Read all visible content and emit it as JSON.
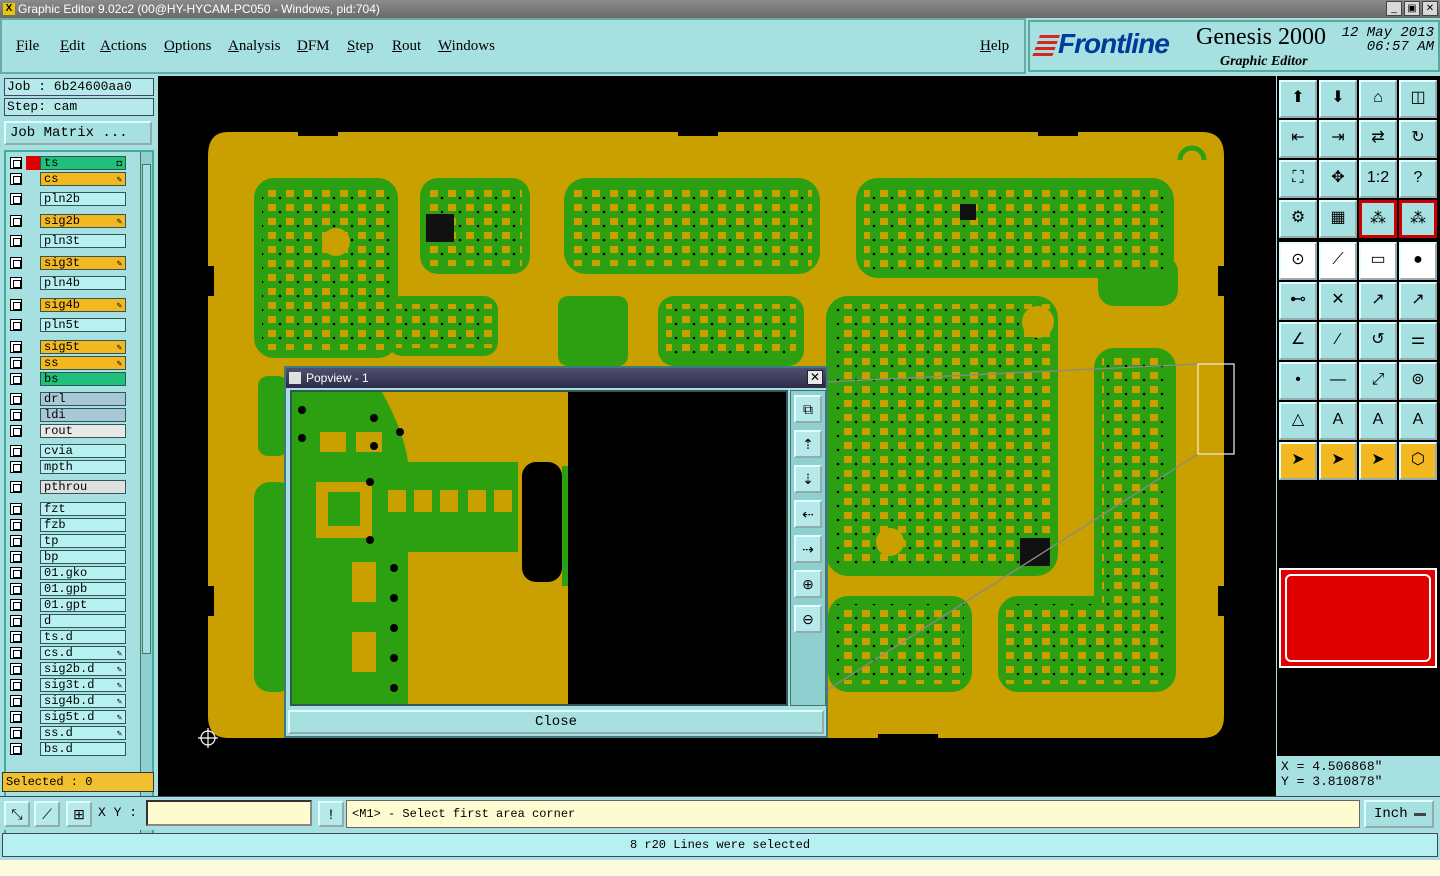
{
  "window": {
    "title": "Graphic Editor 9.02c2 (00@HY-HYCAM-PC050 - Windows, pid:704)"
  },
  "menu": {
    "items": [
      "File",
      "Edit",
      "Actions",
      "Options",
      "Analysis",
      "DFM",
      "Step",
      "Rout",
      "Windows"
    ],
    "help": "Help"
  },
  "brand": {
    "logo": "Frontline",
    "product": "Genesis 2000",
    "subtitle": "Graphic Editor",
    "date": "12 May 2013",
    "time": "06:57 AM"
  },
  "job": {
    "job_line": "Job : 6b24600aa0",
    "step_line": "Step: cam",
    "matrix_button": "Job Matrix ..."
  },
  "layers": [
    {
      "name": "ts",
      "color": "#1ec07a",
      "swatch": "#e00000",
      "pen": "◘"
    },
    {
      "name": "cs",
      "color": "#f3b820",
      "swatch": "",
      "pen": "✎"
    },
    {
      "name": "pln2b",
      "color": "#b6f0f0",
      "swatch": "",
      "pen": ""
    },
    {
      "name": "sig2b",
      "color": "#f3b820",
      "swatch": "",
      "pen": "✎"
    },
    {
      "name": "pln3t",
      "color": "#b6f0f0",
      "swatch": "",
      "pen": ""
    },
    {
      "name": "sig3t",
      "color": "#f3b820",
      "swatch": "",
      "pen": "✎"
    },
    {
      "name": "pln4b",
      "color": "#b6f0f0",
      "swatch": "",
      "pen": ""
    },
    {
      "name": "sig4b",
      "color": "#f3b820",
      "swatch": "",
      "pen": "✎"
    },
    {
      "name": "pln5t",
      "color": "#b6f0f0",
      "swatch": "",
      "pen": ""
    },
    {
      "name": "sig5t",
      "color": "#f3b820",
      "swatch": "",
      "pen": "✎"
    },
    {
      "name": "ss",
      "color": "#f3b820",
      "swatch": "",
      "pen": "✎"
    },
    {
      "name": "bs",
      "color": "#1ec07a",
      "swatch": "",
      "pen": ""
    },
    {
      "name": "drl",
      "color": "#a8c8d8",
      "swatch": "",
      "pen": ""
    },
    {
      "name": "ldi",
      "color": "#a8c8d8",
      "swatch": "",
      "pen": ""
    },
    {
      "name": "rout",
      "color": "#e8e8e8",
      "swatch": "",
      "pen": ""
    },
    {
      "name": "cvia",
      "color": "#b6f0f0",
      "swatch": "",
      "pen": ""
    },
    {
      "name": "mpth",
      "color": "#b6f0f0",
      "swatch": "",
      "pen": ""
    },
    {
      "name": "pthrou",
      "color": "#e0e0e0",
      "swatch": "",
      "pen": ""
    },
    {
      "name": "fzt",
      "color": "#b6f0f0",
      "swatch": "",
      "pen": ""
    },
    {
      "name": "fzb",
      "color": "#b6f0f0",
      "swatch": "",
      "pen": ""
    },
    {
      "name": "tp",
      "color": "#b6f0f0",
      "swatch": "",
      "pen": ""
    },
    {
      "name": "bp",
      "color": "#b6f0f0",
      "swatch": "",
      "pen": ""
    },
    {
      "name": "01.gko",
      "color": "#b6f0f0",
      "swatch": "",
      "pen": ""
    },
    {
      "name": "01.gpb",
      "color": "#b6f0f0",
      "swatch": "",
      "pen": ""
    },
    {
      "name": "01.gpt",
      "color": "#b6f0f0",
      "swatch": "",
      "pen": ""
    },
    {
      "name": "d",
      "color": "#b6f0f0",
      "swatch": "",
      "pen": ""
    },
    {
      "name": "ts.d",
      "color": "#b6f0f0",
      "swatch": "",
      "pen": ""
    },
    {
      "name": "cs.d",
      "color": "#b6f0f0",
      "swatch": "",
      "pen": "✎"
    },
    {
      "name": "sig2b.d",
      "color": "#b6f0f0",
      "swatch": "",
      "pen": "✎"
    },
    {
      "name": "sig3t.d",
      "color": "#b6f0f0",
      "swatch": "",
      "pen": "✎"
    },
    {
      "name": "sig4b.d",
      "color": "#b6f0f0",
      "swatch": "",
      "pen": "✎"
    },
    {
      "name": "sig5t.d",
      "color": "#b6f0f0",
      "swatch": "",
      "pen": "✎"
    },
    {
      "name": "ss.d",
      "color": "#b6f0f0",
      "swatch": "",
      "pen": "✎"
    },
    {
      "name": "bs.d",
      "color": "#b6f0f0",
      "swatch": "",
      "pen": ""
    }
  ],
  "selected": "Selected : 0",
  "popview": {
    "title": "Popview - 1",
    "close_label": "Close",
    "tools": [
      "zoom-fit-icon",
      "pan-up-icon",
      "pan-down-icon",
      "pan-left-icon",
      "pan-right-icon",
      "zoom-in-icon",
      "zoom-out-icon"
    ]
  },
  "right_tools": {
    "icons": [
      "home-up-icon",
      "home-down-icon",
      "home-icon",
      "split-view-icon",
      "pan-left-icon",
      "pan-right-icon",
      "mirror-icon",
      "redraw-icon",
      "zoom-fit-icon",
      "zoom-center-icon",
      "ratio-icon",
      "help-icon",
      "settings-icon",
      "grid-icon",
      "snap-icon",
      "snap-alt-icon",
      "add-pad-icon",
      "add-line-icon",
      "measure-icon",
      "add-circle-icon",
      "connect-icon",
      "delete-icon",
      "move-icon",
      "move-alt-icon",
      "angle-icon",
      "slash-icon",
      "arc-icon",
      "align-icon",
      "add-point-icon",
      "cut-icon",
      "resize-icon",
      "copy-icon",
      "polygon-icon",
      "text-icon",
      "text-alt-icon",
      "text-bold-icon",
      "select-icon",
      "select-box-icon",
      "select-poly-icon",
      "select-net-icon"
    ],
    "ratio_label": "1:2"
  },
  "coords": {
    "x": "X  =  4.506868\"",
    "y": "Y  =  3.810878\""
  },
  "bottom": {
    "xy_label": "X Y :",
    "xy_value": "",
    "prompt": "<M1> - Select first area corner",
    "units": "Inch"
  },
  "status": "8 r20 Lines were selected",
  "colors": {
    "board": "#c9a000",
    "copper": "#2da012",
    "background": "#000000",
    "panel": "#a6e0e0",
    "highlight": "#e00000"
  }
}
